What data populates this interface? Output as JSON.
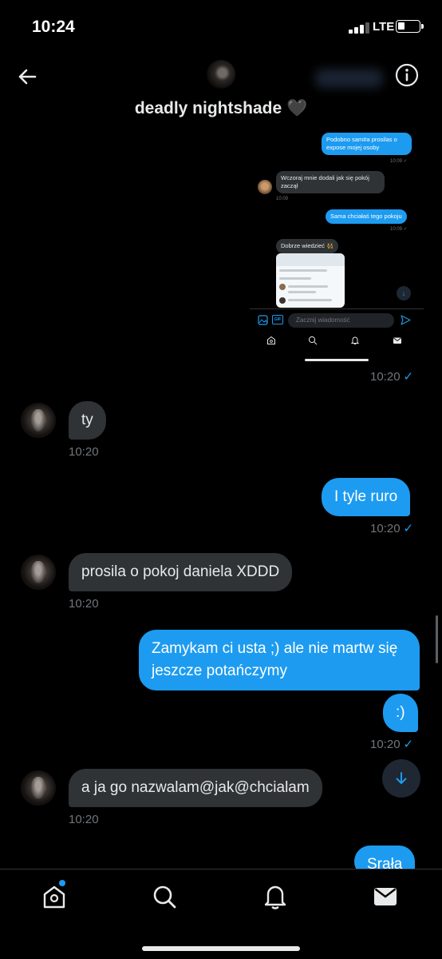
{
  "status_bar": {
    "time": "10:24",
    "network": "LTE"
  },
  "header": {
    "name": "deadly nightshade 🖤"
  },
  "embed": {
    "messages": [
      {
        "dir": "out",
        "text": "Podobno sam#a prosilas o expose mojej osoby",
        "time": "10:09 ✓"
      },
      {
        "dir": "in",
        "text": "Wczoraj mnie dodali jak się pokój zaczął",
        "time": "10:09"
      },
      {
        "dir": "out",
        "text": "Sama chciałaś tego pokoju",
        "time": "10:09 ✓"
      },
      {
        "dir": "in",
        "text": "Dobrze wiedzieć 👯‍♀️",
        "time": ""
      }
    ],
    "compose_placeholder": "Zacznij wiadomość",
    "gif_label": "GIF"
  },
  "messages": [
    {
      "dir": "out",
      "text": "",
      "time": "10:20"
    },
    {
      "dir": "in",
      "text": "ty",
      "time": "10:20"
    },
    {
      "dir": "out",
      "text": "I tyle ruro",
      "time": "10:20"
    },
    {
      "dir": "in",
      "text": "prosila o pokoj daniela XDDD",
      "time": "10:20"
    },
    {
      "dir": "out",
      "text": "Zamykam ci usta ;) ale nie martw się jeszcze potańczymy",
      "time": ""
    },
    {
      "dir": "out",
      "text": ":)",
      "time": "10:20"
    },
    {
      "dir": "in",
      "text": "a ja go nazwalam@jak@chcialam",
      "time": "10:20"
    },
    {
      "dir": "out",
      "text": "Srała",
      "time": ""
    }
  ],
  "colors": {
    "accent": "#1d9bf0",
    "incoming": "#2f3336",
    "background": "#000000"
  },
  "icons": {
    "back": "arrow-left-icon",
    "info": "info-icon",
    "tabs": [
      "home-icon",
      "search-icon",
      "bell-icon",
      "mail-icon"
    ]
  }
}
